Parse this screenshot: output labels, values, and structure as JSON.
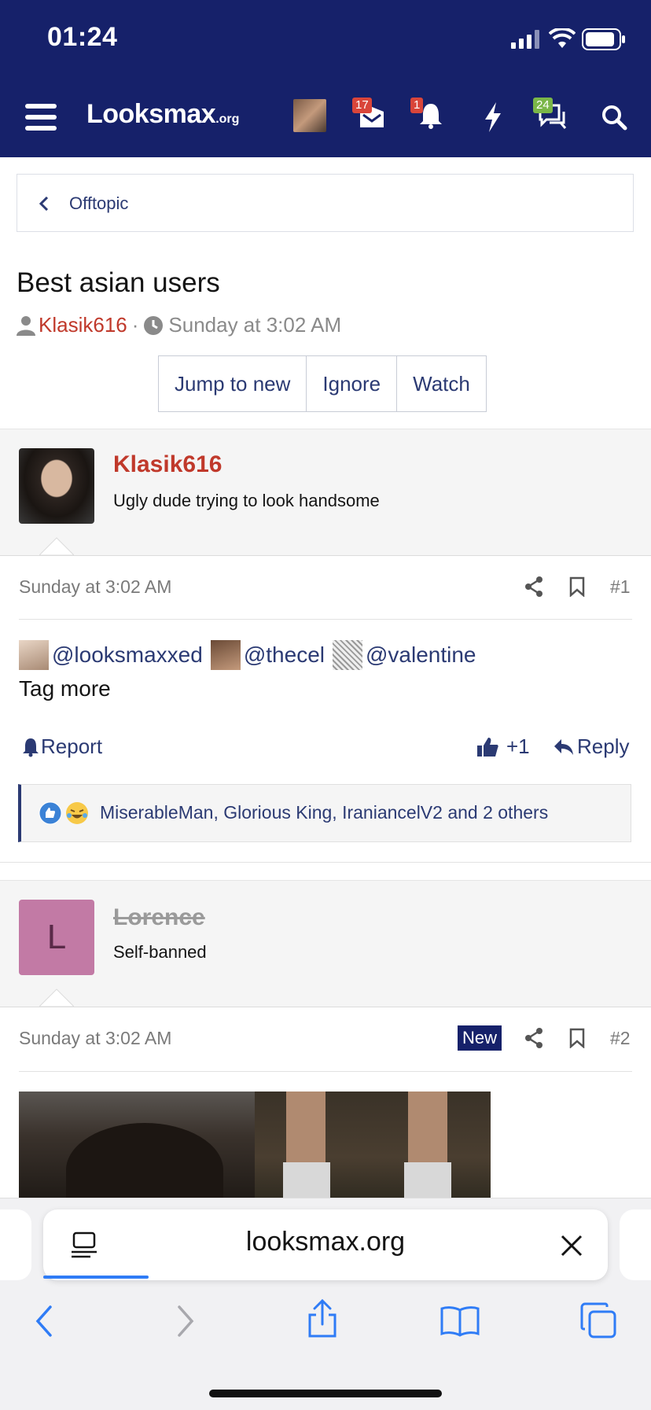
{
  "status": {
    "time": "01:24"
  },
  "nav": {
    "logo": "Looksmax",
    "logo_suffix": ".org",
    "badges": {
      "inbox": "17",
      "alerts": "1",
      "messages": "24"
    },
    "colors": {
      "bar": "#16216a",
      "badge_red": "#d9453a",
      "badge_green": "#7ab648"
    }
  },
  "breadcrumb": {
    "label": "Offtopic"
  },
  "thread": {
    "title": "Best asian users",
    "author": "Klasik616",
    "separator": "·",
    "date": "Sunday at 3:02 AM",
    "buttons": [
      "Jump to new",
      "Ignore",
      "Watch"
    ]
  },
  "posts": [
    {
      "username": "Klasik616",
      "user_title": "Ugly dude trying to look handsome",
      "date": "Sunday at 3:02 AM",
      "number": "#1",
      "mentions": [
        "@looksmaxxed",
        "@thecel",
        "@valentine"
      ],
      "text": "Tag more",
      "report": "Report",
      "like_count": "+1",
      "reply": "Reply",
      "reactions": "MiserableMan, Glorious King, IraniancelV2 and 2 others"
    },
    {
      "username": "Lorence",
      "avatar_letter": "L",
      "user_title": "Self-banned",
      "date": "Sunday at 3:02 AM",
      "new_label": "New",
      "number": "#2"
    }
  ],
  "safari": {
    "url": "looksmax.org"
  },
  "icons": [
    "menu-icon",
    "inbox-icon",
    "bell-icon",
    "bolt-icon",
    "chat-icon",
    "search-icon",
    "share-icon",
    "bookmark-icon",
    "thumbs-up-icon",
    "reply-icon",
    "bell-report-icon",
    "back-icon",
    "forward-icon",
    "share-sheet-icon",
    "bookmarks-icon",
    "tabs-icon"
  ]
}
